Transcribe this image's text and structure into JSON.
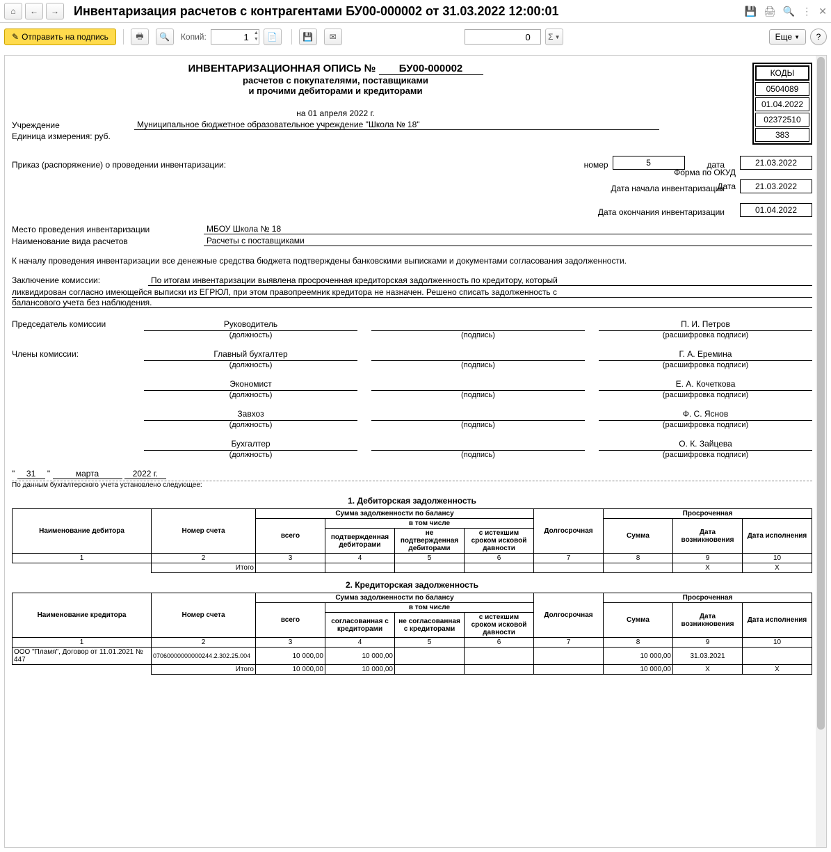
{
  "window": {
    "title": "Инвентаризация расчетов с контрагентами БУ00-000002 от 31.03.2022 12:00:01"
  },
  "toolbar": {
    "send": "Отправить на подпись",
    "copies_label": "Копий:",
    "copies_value": "1",
    "zero_value": "0",
    "more": "Еще",
    "sigma": "Σ",
    "help": "?"
  },
  "doc": {
    "title1_prefix": "ИНВЕНТАРИЗАЦИОННАЯ ОПИСЬ №",
    "doc_number": "БУ00-000002",
    "title2": "расчетов с покупателями, поставщиками",
    "title3": "и прочими дебиторами и кредиторами",
    "on_date": "на 01 апреля 2022 г.",
    "codes_hdr": "КОДЫ",
    "okud_label": "Форма по ОКУД",
    "okud": "0504089",
    "date_label": "Дата",
    "date": "01.04.2022",
    "org_code": "02372510",
    "unit_code": "383",
    "org_label": "Учреждение",
    "org": "Муниципальное бюджетное образовательное учреждение \"Школа № 18\"",
    "unit_label": "Единица измерения: руб.",
    "order_label": "Приказ (распоряжение) о проведении инвентаризации:",
    "order_num_label": "номер",
    "order_num": "5",
    "order_date_label": "дата",
    "order_date": "21.03.2022",
    "inv_start_label": "Дата начала инвентаризации",
    "inv_start": "21.03.2022",
    "inv_end_label": "Дата окончания инвентаризации",
    "inv_end": "01.04.2022",
    "place_label": "Место проведения инвентаризации",
    "place": "МБОУ Школа № 18",
    "kind_label": "Наименование вида расчетов",
    "kind": "Расчеты с поставщиками",
    "intro": "К началу проведения инвентаризации все денежные средства бюджета подтверждены банковскими выписками и документами согласования задолженности.",
    "concl_label": "Заключение комиссии:",
    "conclusion": "По итогам инвентаризации выявлена просроченная кредиторская задолженность по кредитору, который ликвидирован согласно имеющейся выписки из ЕГРЮЛ, при этом правопреемник кредитора не назначен. Решено списать задолженность с балансового учета без наблюдения.",
    "chairman_label": "Председатель комиссии",
    "members_label": "Члены комиссии:",
    "sig_pos": "(должность)",
    "sig_sign": "(подпись)",
    "sig_name": "(расшифровка подписи)",
    "signers": [
      {
        "pos": "Руководитель",
        "name": "П. И. Петров"
      },
      {
        "pos": "Главный бухгалтер",
        "name": "Г. А. Еремина"
      },
      {
        "pos": "Экономист",
        "name": "Е. А. Кочеткова"
      },
      {
        "pos": "Завхоз",
        "name": "Ф. С. Яснов"
      },
      {
        "pos": "Бухгалтер",
        "name": "О. К. Зайцева"
      }
    ],
    "date_d": "31",
    "date_m": "марта",
    "date_y": "2022 г.",
    "quote_open": "\" ",
    "quote_close": " \"",
    "foot_note": "По данным бухгалтерского учета установлено следующее:",
    "sec1": "1.  Дебиторская задолженность",
    "sec2": "2.  Кредиторская задолженность",
    "tbl": {
      "deb_name": "Наименование дебитора",
      "cred_name": "Наименование кредитора",
      "acct": "Номер счета",
      "balance": "Сумма задолженности по балансу",
      "including": "в том числе",
      "total": "всего",
      "confirmed_deb": "подтвержденная дебиторами",
      "unconfirmed_deb": "не подтвержденная дебиторами",
      "confirmed_cred": "согласованная с кредиторами",
      "unconfirmed_cred": "не согласованная с кредиторами",
      "expired": "с истекшим сроком исковой давности",
      "longterm": "Долгосрочная",
      "overdue": "Просроченная",
      "sum": "Сумма",
      "date_origin": "Дата возникновения",
      "date_exec": "Дата исполнения",
      "itogo": "Итого",
      "x": "Х"
    },
    "cred_row": {
      "name": "ООО \"Пламя\", Договор от 11.01.2021 № 447",
      "acct": "07060000000000244.2.302.25.004",
      "total": "10 000,00",
      "confirmed": "10 000,00",
      "overdue_sum": "10 000,00",
      "overdue_date": "31.03.2021"
    },
    "cred_total": {
      "total": "10 000,00",
      "confirmed": "10 000,00",
      "overdue_sum": "10 000,00"
    },
    "cols": [
      "1",
      "2",
      "3",
      "4",
      "5",
      "6",
      "7",
      "8",
      "9",
      "10"
    ]
  }
}
